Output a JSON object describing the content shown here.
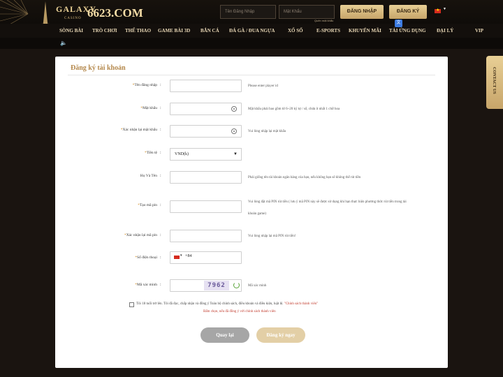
{
  "header": {
    "brand": "GALAXY",
    "brand_sub": "CASINO",
    "domain": "6623.COM",
    "username_placeholder": "Tên Đăng Nhập",
    "password_placeholder": "Mật Khẩu",
    "forgot_password": "Quên mật khẩu",
    "login_button": "ĐĂNG NHẬP",
    "register_button": "ĐĂNG KÝ",
    "language_flag": "vietnam-flag-icon"
  },
  "nav": {
    "items": [
      "SÒNG BÀI",
      "TRÒ CHƠI",
      "THỂ THAO",
      "GAME BÀI 3D",
      "BẮN CÁ",
      "ĐÁ GÀ / ĐUA NGỰA",
      "XỔ SỐ",
      "E-SPORTS",
      "KHUYẾN MÃI",
      "TẢI ỨNG DỤNG",
      "ĐẠI LÝ",
      "VIP"
    ]
  },
  "contact_tab": "CONTACT US",
  "form": {
    "title": "Đăng ký tài khoản",
    "fields": [
      {
        "label": "Tên đăng nhập",
        "hint": "Please enter player id"
      },
      {
        "label": "Mật khẩu",
        "hint": "Mật khẩu phải bao gồm từ 6~20 ký tự / số, chứa ít nhất 1 chữ hoa"
      },
      {
        "label": "Xác nhận lại mật khẩu",
        "hint": "Vui lòng nhập lại mật khẩu"
      },
      {
        "label": "Tiền tệ",
        "value": "VND(k)"
      },
      {
        "label": "Họ Và Tên",
        "hint": "Phải giống tên tài khoản ngân hàng của bạn, nếu không bạn sẽ không thể rút tiền"
      },
      {
        "label": "Tạo mã pin",
        "hint": "Vui lòng đặt mã PIN rút tiền ( lưu ý mã PIN này sẽ được sử dụng khi bạn thực hiện phương thức rút tiền trong tài khoản game)"
      },
      {
        "label": "Xác nhận lại mã pin",
        "hint": "Vui lòng nhập lại mã PIN rút tiền!"
      },
      {
        "label": "Số điện thoại",
        "country_code": "+84"
      },
      {
        "label": "Mã xác minh",
        "captcha": "7962",
        "hint": "Mã xác minh"
      }
    ],
    "terms_text": "Tôi 18 tuổi trở lên. Tôi đã đọc, chấp nhận và đồng ý Toàn bộ chính sách, điều khoản và điều kiện, luật lệ.",
    "terms_link": "\"Chính sách thành viên\"",
    "terms_warning": "Bấm chọn, nếu đã đồng ý với chính sách thành viên",
    "back_button": "Quay lại",
    "submit_button": "Đăng ký ngay"
  }
}
